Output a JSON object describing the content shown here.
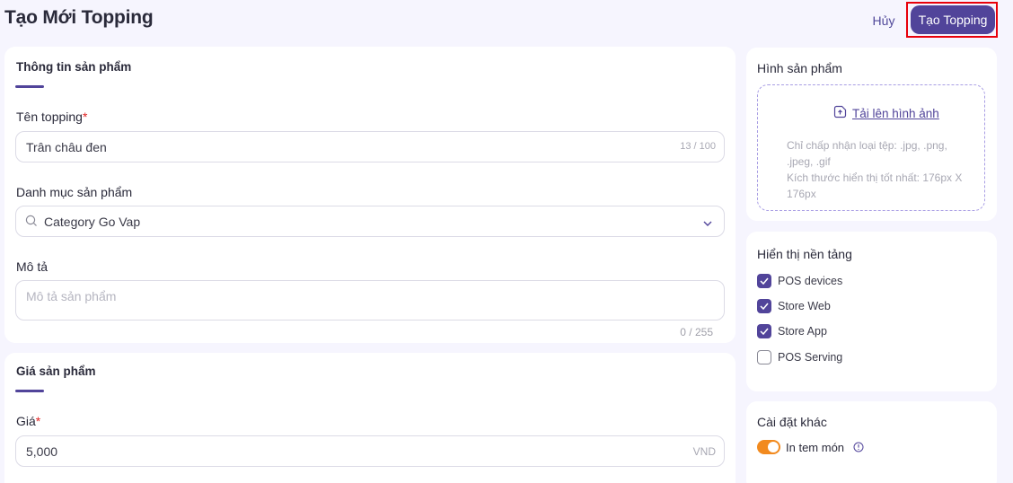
{
  "header": {
    "title": "Tạo Mới Topping",
    "cancel_label": "Hủy",
    "create_label": "Tạo Topping"
  },
  "product_info": {
    "section_title": "Thông tin sản phẩm",
    "name": {
      "label": "Tên topping",
      "required_mark": "*",
      "value": "Trân châu đen",
      "counter": "13 / 100"
    },
    "category": {
      "label": "Danh mục sản phẩm",
      "value": "Category Go Vap"
    },
    "description": {
      "label": "Mô tả",
      "placeholder": "Mô tả sản phẩm",
      "counter": "0 / 255"
    }
  },
  "price": {
    "section_title": "Giá sản phẩm",
    "label": "Giá",
    "required_mark": "*",
    "value": "5,000",
    "currency": "VND"
  },
  "image": {
    "title": "Hình sản phẩm",
    "upload_label": "Tải lên hình ảnh",
    "hint_types": "Chỉ chấp nhận loại tệp: .jpg, .png, .jpeg, .gif",
    "hint_size": "Kích thước hiển thị tốt nhất: 176px X 176px"
  },
  "platforms": {
    "title": "Hiển thị nền tảng",
    "items": [
      {
        "label": "POS devices",
        "checked": true
      },
      {
        "label": "Store Web",
        "checked": true
      },
      {
        "label": "Store App",
        "checked": true
      },
      {
        "label": "POS Serving",
        "checked": false
      }
    ]
  },
  "other_settings": {
    "title": "Cài đặt khác",
    "print_label": "In tem món",
    "print_enabled": true
  },
  "colors": {
    "primary": "#51449a",
    "toggle_on": "#f28a1e",
    "required": "#e02424"
  }
}
